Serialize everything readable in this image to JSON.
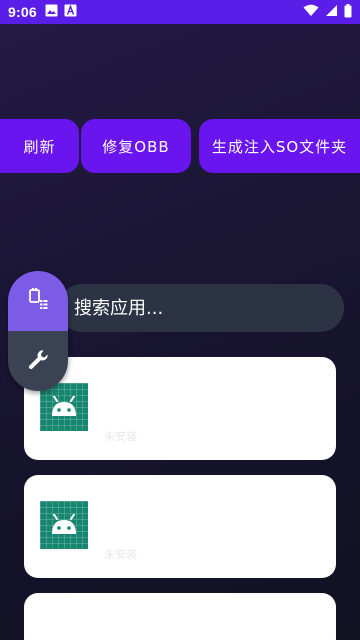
{
  "status_bar": {
    "time": "9:06",
    "notification_icons": [
      "image-icon",
      "font-a-icon"
    ],
    "system_icons": [
      "wifi-icon",
      "signal-icon",
      "battery-icon"
    ],
    "color": "#5b1ee8"
  },
  "toolbar": {
    "refresh_label": "刷新",
    "fix_obb_label": "修复OBB",
    "generate_so_label": "生成注入SO文件夹",
    "accent": "#6a14f0"
  },
  "search": {
    "placeholder": "搜索应用..."
  },
  "fab": {
    "top_icon": "app-list-icon",
    "bottom_icon": "wrench-icon",
    "top_color": "#7c5ce6",
    "bottom_color": "#3a4254"
  },
  "apps": [
    {
      "icon": "android-icon",
      "status": "未安装"
    },
    {
      "icon": "android-icon",
      "status": "未安装"
    },
    {
      "icon": "android-icon",
      "status": ""
    }
  ]
}
